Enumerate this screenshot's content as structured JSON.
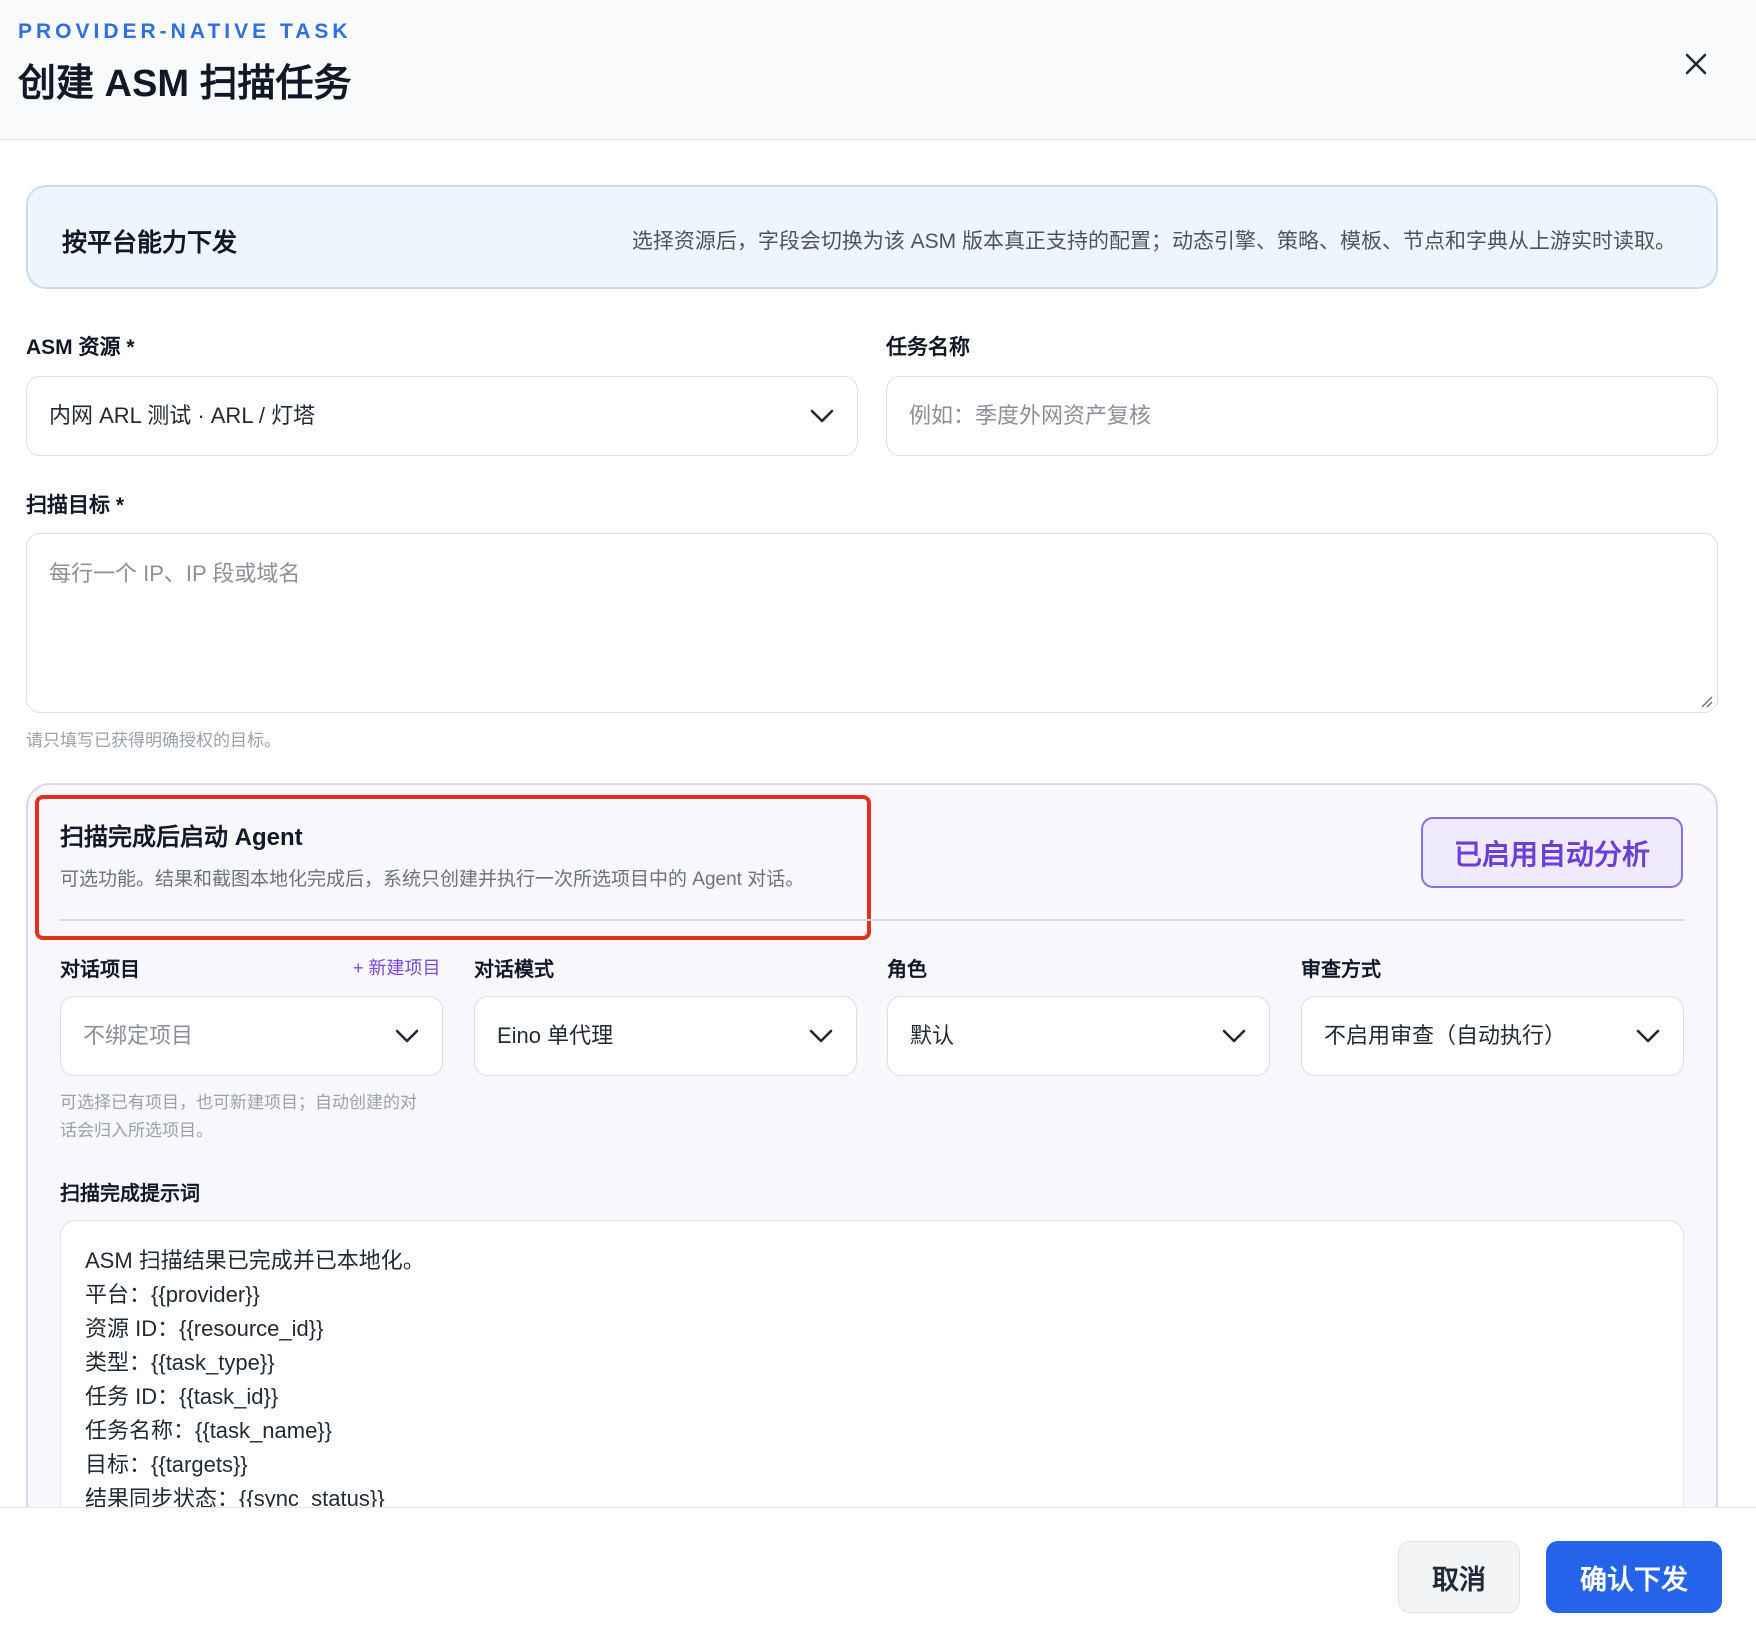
{
  "header": {
    "eyebrow": "PROVIDER-NATIVE TASK",
    "title": "创建 ASM 扫描任务"
  },
  "info": {
    "title": "按平台能力下发",
    "description": "选择资源后，字段会切换为该 ASM 版本真正支持的配置；动态引擎、策略、模板、节点和字典从上游实时读取。"
  },
  "form": {
    "resource_label": "ASM 资源 *",
    "resource_value": "内网 ARL 测试 · ARL / 灯塔",
    "task_name_label": "任务名称",
    "task_name_placeholder": "例如：季度外网资产复核",
    "targets_label": "扫描目标 *",
    "targets_placeholder": "每行一个 IP、IP 段或域名",
    "targets_hint": "请只填写已获得明确授权的目标。"
  },
  "agent": {
    "title": "扫描完成后启动 Agent",
    "description": "可选功能。结果和截图本地化完成后，系统只创建并执行一次所选项目中的 Agent 对话。",
    "toggle_label": "已启用自动分析",
    "project_label": "对话项目",
    "new_project": "+ 新建项目",
    "project_placeholder": "不绑定项目",
    "project_hint_1": "可选择已有项目，也可新建项目；自动创建的对",
    "project_hint_2": "话会归入所选项目。",
    "mode_label": "对话模式",
    "mode_value": "Eino 单代理",
    "role_label": "角色",
    "role_value": "默认",
    "review_label": "审查方式",
    "review_value": "不启用审查（自动执行）",
    "prompt_label": "扫描完成提示词",
    "prompt_lines": [
      "ASM 扫描结果已完成并已本地化。",
      "平台：{{provider}}",
      "资源 ID：{{resource_id}}",
      "类型：{{task_type}}",
      "任务 ID：{{task_id}}",
      "任务名称：{{task_name}}",
      "目标：{{targets}}",
      "结果同步状态：{{sync_status}}"
    ]
  },
  "footer": {
    "cancel": "取消",
    "confirm": "确认下发"
  },
  "icons": {
    "close": "close-icon",
    "chevron": "chevron-down-icon",
    "resize": "resize-grip-icon"
  },
  "colors": {
    "accent_blue": "#2563eb",
    "eyebrow_blue": "#2f6fe0",
    "purple": "#6b3fd6",
    "highlight_red": "#e0301e"
  }
}
